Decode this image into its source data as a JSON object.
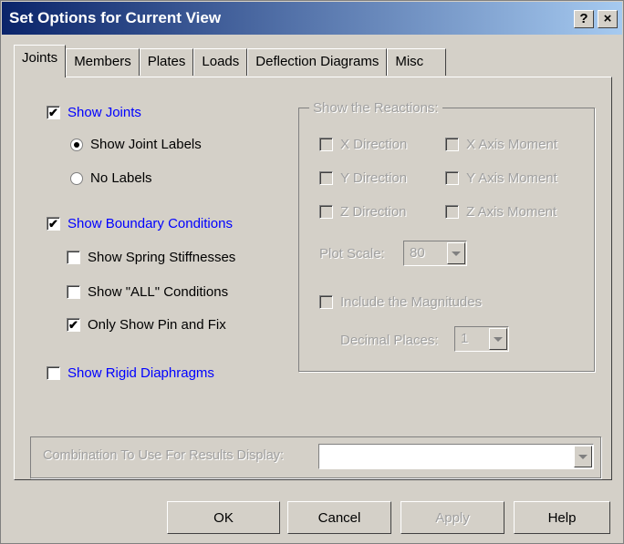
{
  "window": {
    "title": "Set Options for Current View",
    "help_label": "?",
    "close_label": "×"
  },
  "tabs": [
    {
      "label": "Joints",
      "active": true
    },
    {
      "label": "Members"
    },
    {
      "label": "Plates"
    },
    {
      "label": "Loads"
    },
    {
      "label": "Deflection Diagrams"
    },
    {
      "label": "Misc"
    }
  ],
  "joints": {
    "show_joints": {
      "label": "Show Joints",
      "checked": true
    },
    "show_joint_labels": {
      "label": "Show Joint Labels",
      "selected": true
    },
    "no_labels": {
      "label": "No Labels",
      "selected": false
    },
    "show_boundary": {
      "label": "Show Boundary Conditions",
      "checked": true
    },
    "spring_stiff": {
      "label": "Show Spring Stiffnesses",
      "checked": false
    },
    "all_conditions": {
      "label": "Show \"ALL\" Conditions",
      "checked": false
    },
    "pin_fix": {
      "label": "Only Show Pin and Fix",
      "checked": true
    },
    "rigid_diaphragms": {
      "label": "Show Rigid Diaphragms",
      "checked": false
    }
  },
  "reactions": {
    "legend": "Show the Reactions:",
    "x_dir": "X Direction",
    "y_dir": "Y Direction",
    "z_dir": "Z Direction",
    "x_moment": "X Axis Moment",
    "y_moment": "Y Axis Moment",
    "z_moment": "Z Axis Moment",
    "plot_scale_label": "Plot Scale:",
    "plot_scale_value": "80",
    "include_magnitudes": "Include the Magnitudes",
    "decimal_places_label": "Decimal Places:",
    "decimal_places_value": "1"
  },
  "combination": {
    "label": "Combination To Use For Results Display:",
    "value": ""
  },
  "buttons": {
    "ok": "OK",
    "cancel": "Cancel",
    "apply": "Apply",
    "help": "Help"
  },
  "colors": {
    "title_start": "#0a246a",
    "title_end": "#a6caf0",
    "link_blue": "#0000ff",
    "face": "#d4d0c8"
  }
}
